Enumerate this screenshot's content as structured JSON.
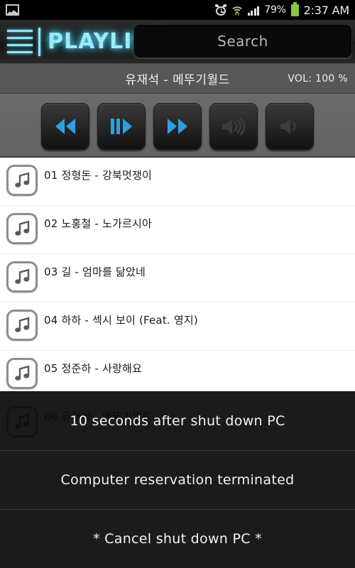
{
  "statusbar": {
    "gallery_icon": "gallery-icon",
    "alarm_icon": "alarm-clock-icon",
    "wifi_icon": "wifi-icon",
    "signal_icon": "cell-signal-icon",
    "battery_percent": "79%",
    "battery_icon": "battery-icon",
    "clock": "2:37 AM",
    "battery_color": "#8bc53f"
  },
  "header": {
    "menu_icon": "hamburger-menu-icon",
    "app_title": "PLAYLIST",
    "accent_color": "#8fe6f8",
    "search": {
      "placeholder": "Search",
      "value": ""
    }
  },
  "nowplaying": {
    "title": "유재석 - 메뚜기월드",
    "volume_label": "VOL: 100 %"
  },
  "transport": {
    "buttons": [
      {
        "name": "rewind-button",
        "label": "Rewind",
        "icon": "rewind-icon",
        "color": "#2f9fe0"
      },
      {
        "name": "play-pause-button",
        "label": "Play / Pause",
        "icon": "play-pause-icon",
        "color": "#2f9fe0"
      },
      {
        "name": "fast-forward-button",
        "label": "Fast Forward",
        "icon": "fast-forward-icon",
        "color": "#2f9fe0"
      },
      {
        "name": "volume-up-button",
        "label": "Volume Up",
        "icon": "volume-up-icon",
        "color": "#3b3b3b"
      },
      {
        "name": "volume-down-button",
        "label": "Volume Down",
        "icon": "volume-down-icon",
        "color": "#3b3b3b"
      }
    ]
  },
  "playlist": {
    "tracks": [
      {
        "label": "01 정형돈 - 강북멋쟁이",
        "icon": "music-note-icon"
      },
      {
        "label": "02 노홍철 - 노가르시아",
        "icon": "music-note-icon"
      },
      {
        "label": "03 길 - 엄마를 닮았네",
        "icon": "music-note-icon"
      },
      {
        "label": "04 하하 - 섹시 보이 (Feat. 영지)",
        "icon": "music-note-icon"
      },
      {
        "label": "05 정준하 - 사랑해요",
        "icon": "music-note-icon"
      },
      {
        "label": "06 유재석 - 메뚜기월드",
        "icon": "music-note-icon"
      }
    ]
  },
  "dialog": {
    "options": [
      {
        "label": "10 seconds after shut down PC"
      },
      {
        "label": "Computer reservation terminated"
      },
      {
        "label": "* Cancel shut down PC *"
      }
    ]
  }
}
